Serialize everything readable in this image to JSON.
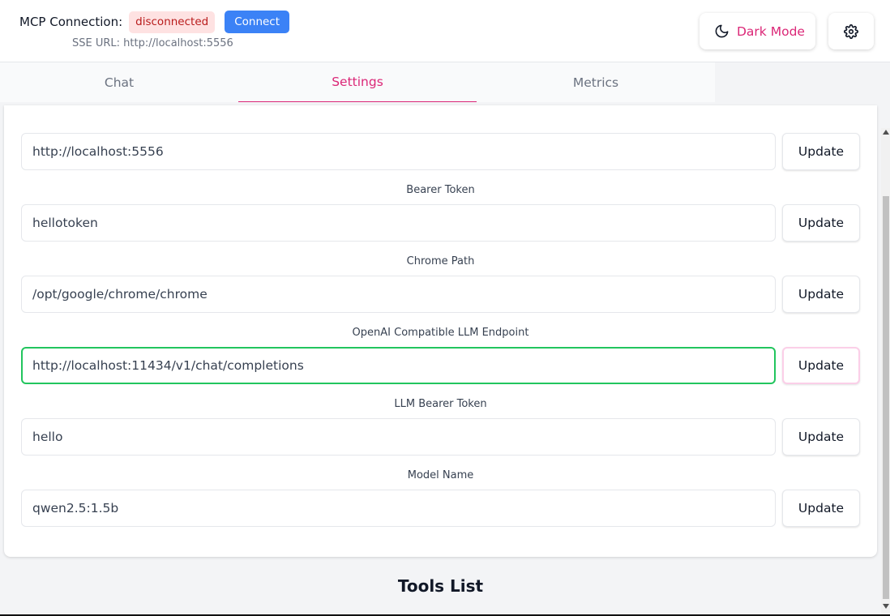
{
  "header": {
    "connection_label": "MCP Connection:",
    "status": "disconnected",
    "connect_label": "Connect",
    "sse_url": "SSE URL: http://localhost:5556",
    "dark_mode_label": "Dark Mode",
    "moon_icon": "moon-icon",
    "gear_icon": "gear-icon"
  },
  "tabs": [
    {
      "label": "Chat",
      "active": false
    },
    {
      "label": "Settings",
      "active": true
    },
    {
      "label": "Metrics",
      "active": false
    }
  ],
  "settings": {
    "update_label": "Update",
    "fields": [
      {
        "label": "",
        "value": "http://localhost:5556"
      },
      {
        "label": "Bearer Token",
        "value": "hellotoken"
      },
      {
        "label": "Chrome Path",
        "value": "/opt/google/chrome/chrome"
      },
      {
        "label": "OpenAI Compatible LLM Endpoint",
        "value": "http://localhost:11434/v1/chat/completions",
        "focused": true
      },
      {
        "label": "LLM Bearer Token",
        "value": "hello"
      },
      {
        "label": "Model Name",
        "value": "qwen2.5:1.5b"
      }
    ]
  },
  "tools": {
    "title": "Tools List"
  },
  "colors": {
    "accent": "#db2777",
    "primary_button": "#3b82f6",
    "status_bg": "#fee2e2",
    "status_text": "#b91c1c",
    "focus_border": "#22c55e"
  }
}
